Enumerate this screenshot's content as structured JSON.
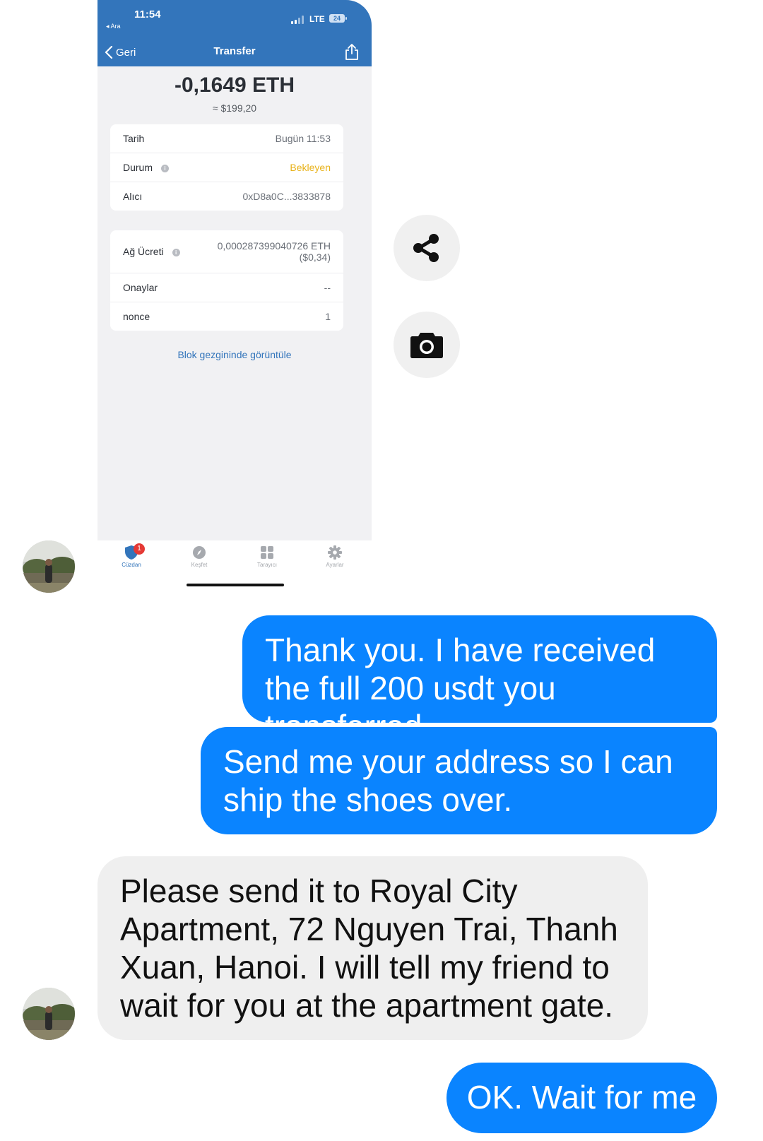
{
  "phone_status": {
    "time": "11:54",
    "back_app": "◂ Ara",
    "network": "LTE",
    "battery": "24"
  },
  "nav": {
    "back_label": "Geri",
    "title": "Transfer"
  },
  "transaction": {
    "amount": "-0,1649 ETH",
    "usd": "≈ $199,20",
    "details": [
      {
        "label": "Tarih",
        "value": "Bugün 11:53"
      },
      {
        "label": "Durum",
        "value": "Bekleyen"
      },
      {
        "label": "Alıcı",
        "value": "0xD8a0C...3833878"
      }
    ],
    "fees": {
      "fee_label": "Ağ Ücreti",
      "fee_value": "0,000287399040726 ETH",
      "fee_usd": "($0,34)",
      "confirmations_label": "Onaylar",
      "confirmations_value": "--",
      "nonce_label": "nonce",
      "nonce_value": "1"
    },
    "explorer_link": "Blok gezgininde görüntüle"
  },
  "tabbar": {
    "tabs": [
      {
        "label": "Cüzdan",
        "icon": "shield-icon"
      },
      {
        "label": "Keşfet",
        "icon": "compass-icon"
      },
      {
        "label": "Tarayıcı",
        "icon": "grid-icon"
      },
      {
        "label": "Ayarlar",
        "icon": "gear-icon"
      }
    ],
    "badge": "1"
  },
  "colors": {
    "trust_blue": "#3375bb",
    "pending": "#e8b21a",
    "bubble_out": "#0a84ff",
    "bubble_in": "#efefef"
  },
  "messages": [
    {
      "from": "me",
      "text": "Thank you. I have received the full 200 usdt you transferred."
    },
    {
      "from": "me",
      "text": "Send me your address so I can ship the shoes over."
    },
    {
      "from": "them",
      "text": "Please send it to Royal City Apartment, 72 Nguyen Trai, Thanh Xuan, Hanoi. I will tell my friend to wait for you at the apartment gate."
    },
    {
      "from": "me",
      "text": "OK. Wait for me"
    }
  ]
}
